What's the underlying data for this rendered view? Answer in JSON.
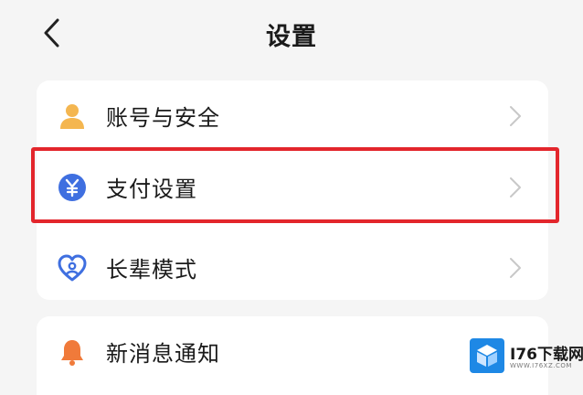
{
  "header": {
    "title": "设置"
  },
  "menu": {
    "items": [
      {
        "label": "账号与安全",
        "icon": "user-icon"
      },
      {
        "label": "支付设置",
        "icon": "yuan-icon"
      },
      {
        "label": "长辈模式",
        "icon": "heart-icon"
      },
      {
        "label": "新消息通知",
        "icon": "bell-icon"
      }
    ]
  },
  "watermark": {
    "title": "I76下载网",
    "subtitle": "WWW.I76XZ.COM"
  },
  "colors": {
    "highlight": "#e3262c",
    "user_icon": "#f4b650",
    "yuan_icon": "#3f6fe0",
    "heart_icon": "#3f6fe0",
    "bell_icon": "#f07a3a"
  }
}
